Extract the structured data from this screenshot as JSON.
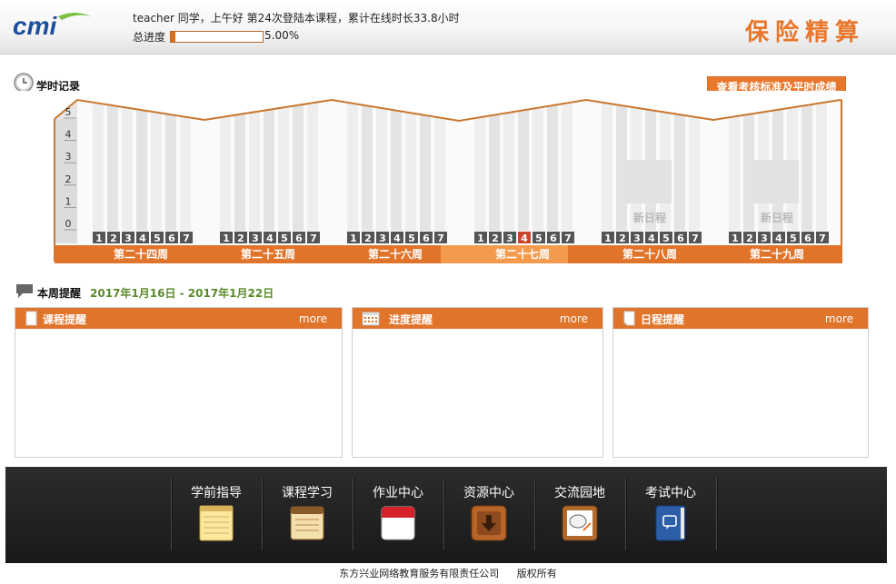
{
  "header": {
    "logo_text": "cmi",
    "greeting": "teacher 同学，上午好  第24次登陆本课程，累计在线时长33.8小时",
    "progress_label": "总进度",
    "progress_value": "5.00%",
    "progress_fraction": 0.05,
    "app_title": "保险精算"
  },
  "study": {
    "title": "学时记录",
    "standards_button": "查看考核标准及平时成绩"
  },
  "chart_data": {
    "type": "bar",
    "y_ticks": [
      "5",
      "4",
      "3",
      "2",
      "1",
      "0"
    ],
    "ylim": [
      0,
      5
    ],
    "day_labels": [
      "1",
      "2",
      "3",
      "4",
      "5",
      "6",
      "7"
    ],
    "weeks": [
      {
        "label": "第二十四周",
        "values": [
          0,
          0,
          0,
          0,
          0,
          0,
          0
        ],
        "current": false,
        "placeholder": ""
      },
      {
        "label": "第二十五周",
        "values": [
          0,
          0,
          0,
          0,
          0,
          0,
          0
        ],
        "current": false,
        "placeholder": ""
      },
      {
        "label": "第二十六周",
        "values": [
          0,
          0,
          0,
          0,
          0,
          0,
          0
        ],
        "current": false,
        "placeholder": ""
      },
      {
        "label": "第二十七周",
        "values": [
          0,
          0,
          0,
          0,
          0,
          0,
          0
        ],
        "current": true,
        "today_index": 3,
        "placeholder": ""
      },
      {
        "label": "第二十八周",
        "values": [
          0,
          0,
          0,
          0,
          0,
          0,
          0
        ],
        "current": false,
        "placeholder": "新日程"
      },
      {
        "label": "第二十九周",
        "values": [
          0,
          0,
          0,
          0,
          0,
          0,
          0
        ],
        "current": false,
        "placeholder": "新日程"
      }
    ],
    "colors": {
      "accent": "#e0742a",
      "current_week": "#f39a4c",
      "today": "#c8462e",
      "day_box": "#555555"
    }
  },
  "reminders": {
    "title": "本周提醒",
    "date_range": "2017年1月16日  - 2017年1月22日",
    "panels": [
      {
        "title": "课程提醒",
        "more": "more"
      },
      {
        "title": "进度提醒",
        "more": "more"
      },
      {
        "title": "日程提醒",
        "more": "more"
      }
    ]
  },
  "nav": {
    "items": [
      {
        "label": "学前指导",
        "icon": "notepad-icon"
      },
      {
        "label": "课程学习",
        "icon": "notes-icon"
      },
      {
        "label": "作业中心",
        "icon": "calendar-icon"
      },
      {
        "label": "资源中心",
        "icon": "download-icon"
      },
      {
        "label": "交流园地",
        "icon": "chat-board-icon"
      },
      {
        "label": "考试中心",
        "icon": "book-icon"
      }
    ]
  },
  "footer": {
    "company": "东方兴业网络教育服务有限责任公司",
    "rights": "版权所有"
  }
}
